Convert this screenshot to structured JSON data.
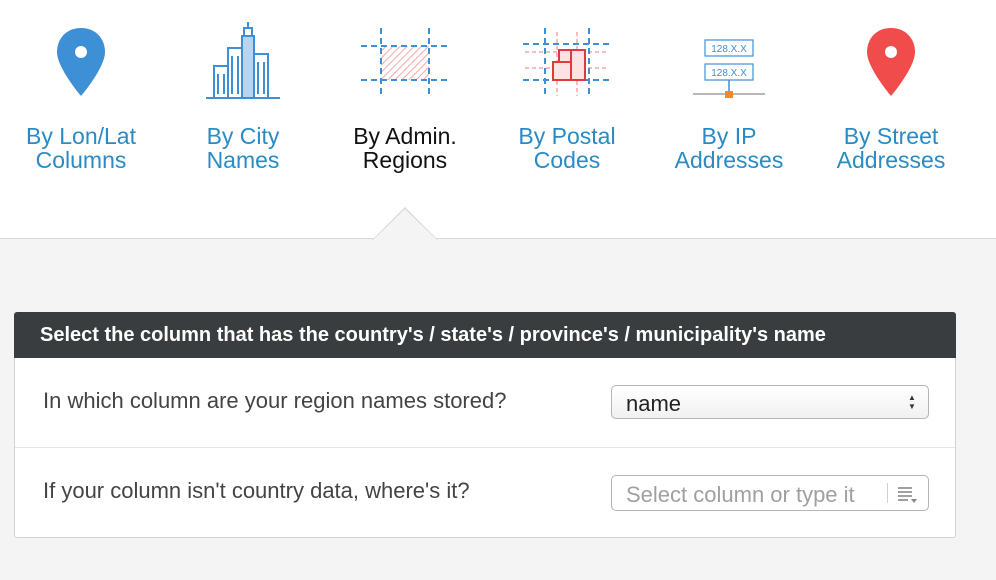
{
  "tabs": [
    {
      "id": "lonlat",
      "line1": "By Lon/Lat",
      "line2": "Columns",
      "icon": "map-pin-blue-icon",
      "color": "#2a8bc4"
    },
    {
      "id": "city",
      "line1": "By City",
      "line2": "Names",
      "icon": "city-skyline-icon",
      "color": "#2a8bc4"
    },
    {
      "id": "admin",
      "line1": "By Admin.",
      "line2": "Regions",
      "icon": "admin-region-grid-icon",
      "color": "#111111",
      "active": true
    },
    {
      "id": "postal",
      "line1": "By Postal",
      "line2": "Codes",
      "icon": "postal-grid-icon",
      "color": "#2a8bc4"
    },
    {
      "id": "ip",
      "line1": "By IP",
      "line2": "Addresses",
      "icon": "ip-network-icon",
      "color": "#2a8bc4",
      "ip_labels": [
        "128.X.X",
        "128.X.X"
      ]
    },
    {
      "id": "street",
      "line1": "By Street",
      "line2": "Addresses",
      "icon": "map-pin-red-icon",
      "color": "#2a8bc4"
    }
  ],
  "panel": {
    "header": "Select the column that has the country's / state's / province's / municipality's name",
    "rows": [
      {
        "question": "In which column are your region names stored?",
        "select_value": "name"
      },
      {
        "question": "If your column isn't country data, where's it?",
        "placeholder": "Select column or type it"
      }
    ]
  },
  "colors": {
    "link_blue": "#2a8bc4",
    "header_bg": "#3a3d40",
    "pin_blue": "#3d8fd6",
    "pin_red": "#f04c4c",
    "page_bg": "#f4f4f4"
  }
}
